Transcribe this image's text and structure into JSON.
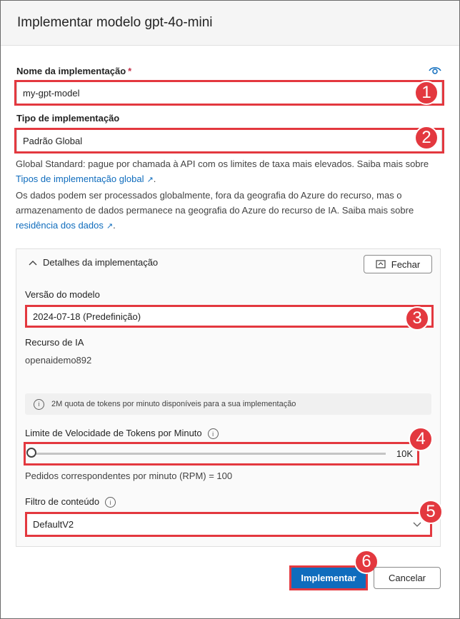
{
  "dialog": {
    "title": "Implementar modelo gpt-4o-mini"
  },
  "deployment_name": {
    "label": "Nome da implementação",
    "required": "*",
    "value": "my-gpt-model"
  },
  "deployment_type": {
    "label": "Tipo de implementação",
    "value": "Padrão Global",
    "help1": "Global Standard: pague por chamada à API com os limites de taxa mais elevados. Saiba mais sobre",
    "link1": "Tipos de implementação global",
    "help2": "Os dados podem ser processados globalmente, fora da geografia do Azure do recurso, mas o armazenamento de dados permanece na geografia do Azure do recurso de IA. Saiba mais sobre",
    "link2": "residência dos dados"
  },
  "details": {
    "header": "Detalhes da implementação",
    "close_label": "Fechar",
    "model_version_label": "Versão do modelo",
    "model_version_value": "2024-07-18 (Predefinição)",
    "resource_label": "Recurso de IA",
    "resource_value": "openaidemo892",
    "quota_info": "2M quota de tokens por minuto disponíveis para a sua implementação",
    "rate_limit_label": "Limite de Velocidade de Tokens por Minuto",
    "rate_limit_value": "10K",
    "rate_limit_fraction": 0.0,
    "rpm_text": "Pedidos correspondentes por minuto (RPM) = 100",
    "content_filter_label": "Filtro de conteúdo",
    "content_filter_value": "DefaultV2"
  },
  "actions": {
    "deploy": "Implementar",
    "cancel": "Cancelar"
  },
  "annotations": [
    "1",
    "2",
    "3",
    "4",
    "5",
    "6"
  ],
  "colors": {
    "annotation_red": "#e3383f",
    "primary": "#0f6cbd"
  }
}
